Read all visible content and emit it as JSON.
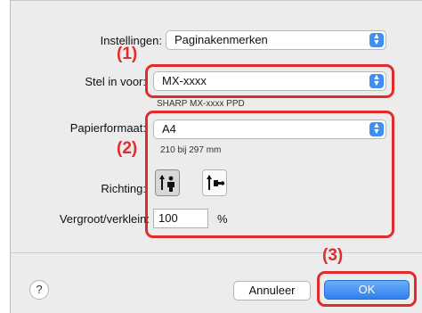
{
  "settings": {
    "label": "Instellingen:",
    "value": "Paginakenmerken"
  },
  "printer": {
    "label": "Stel in voor:",
    "value": "MX-xxxx",
    "subtext": "SHARP MX-xxxx PPD"
  },
  "paper": {
    "label": "Papierformaat:",
    "value": "A4",
    "size_text": "210 bij 297 mm"
  },
  "orientation": {
    "label": "Richting:",
    "options": [
      "portrait-icon",
      "landscape-icon"
    ],
    "selected": "portrait-icon"
  },
  "scale": {
    "label": "Vergroot/verklein:",
    "value": "100",
    "unit": "%"
  },
  "buttons": {
    "help": "?",
    "cancel": "Annuleer",
    "ok": "OK"
  },
  "annotations": {
    "one": "(1)",
    "two": "(2)",
    "three": "(3)"
  },
  "colors": {
    "accent": "#3d8ff3",
    "highlight": "#e32b2b"
  }
}
